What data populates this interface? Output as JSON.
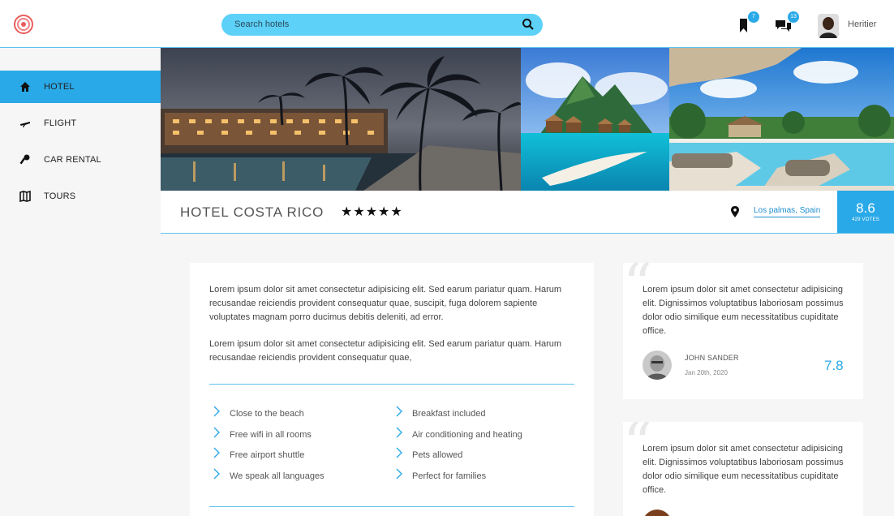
{
  "header": {
    "search_placeholder": "Search hotels",
    "bookmarks_badge": "7",
    "messages_badge": "13",
    "user_name": "Heritier"
  },
  "sidebar": {
    "items": [
      {
        "label": "HOTEL",
        "icon": "home-icon",
        "active": true
      },
      {
        "label": "FLIGHT",
        "icon": "plane-icon",
        "active": false
      },
      {
        "label": "CAR RENTAL",
        "icon": "key-icon",
        "active": false
      },
      {
        "label": "TOURS",
        "icon": "map-icon",
        "active": false
      }
    ]
  },
  "hotel": {
    "name": "HOTEL COSTA RICO",
    "stars": "★★★★★",
    "location": "Los palmas, Spain",
    "score": "8.6",
    "votes": "429 VOTES"
  },
  "description": {
    "paragraphs": [
      "Lorem ipsum dolor sit amet consectetur adipisicing elit. Sed earum pariatur quam. Harum recusandae reiciendis provident consequatur quae, suscipit, fuga dolorem sapiente voluptates magnam porro ducimus debitis deleniti, ad error.",
      "Lorem ipsum dolor sit amet consectetur adipisicing elit. Sed earum pariatur quam. Harum recusandae reiciendis provident consequatur quae,"
    ]
  },
  "features": {
    "left": [
      "Close to the beach",
      "Free wifi in all rooms",
      "Free airport shuttle",
      "We speak all languages"
    ],
    "right": [
      "Breakfast included",
      "Air conditioning and heating",
      "Pets allowed",
      "Perfect for families"
    ]
  },
  "reviews": [
    {
      "text": "Lorem ipsum dolor sit amet consectetur adipisicing elit. Dignissimos voluptatibus laboriosam possimus dolor odio similique eum necessitatibus cupiditate office.",
      "author": "JOHN SANDER",
      "date": "Jan 20th, 2020",
      "score": "7.8"
    },
    {
      "text": "Lorem ipsum dolor sit amet consectetur adipisicing elit. Dignissimos voluptatibus laboriosam possimus dolor odio similique eum necessitatibus cupiditate office."
    }
  ],
  "colors": {
    "accent": "#2aa9e8",
    "search_bg": "#5dd1f8",
    "divider": "#5cc4ef"
  }
}
